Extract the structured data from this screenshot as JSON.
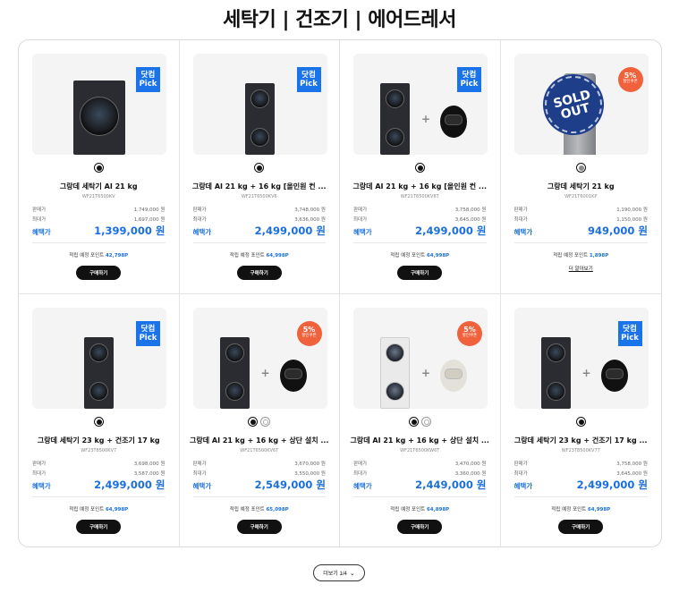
{
  "page": {
    "title": "세탁기 | 건조기 | 에어드레서"
  },
  "labels": {
    "sale_price": "판매가",
    "lowest_price": "최대가",
    "benefit_price": "혜택가",
    "points_label": "적립 예정 포인트",
    "buy": "구매하기",
    "learn_more": "더 알아보기",
    "pick_line1": "닷컴",
    "pick_line2": "Pick",
    "discount_sub": "할인쿠폰",
    "sold_out_1": "SOLD",
    "sold_out_2": "OUT",
    "plus": "+"
  },
  "colors": {
    "accent_blue": "#1a6fdc",
    "pick_badge": "#1a73e8",
    "sale_badge": "#f0623c",
    "button": "#111111"
  },
  "products": [
    {
      "name": "그랑데 세탁기 AI 21 kg",
      "model": "WF21T6500KV",
      "price1": "1,749,000 원",
      "price2": "1,697,000 원",
      "benefit": "1,399,000 원",
      "points": "42,798P",
      "badge": "pick",
      "discount": "",
      "action": "buy",
      "swatches": [
        "#111111"
      ],
      "image": "washer"
    },
    {
      "name": "그랑데 AI 21 kg + 16 kg [올인원 컨 ...",
      "model": "WF21T6500KV6",
      "price1": "3,748,000 원",
      "price2": "3,636,000 원",
      "benefit": "2,499,000 원",
      "points": "64,998P",
      "badge": "pick",
      "discount": "",
      "action": "buy",
      "swatches": [
        "#111111"
      ],
      "image": "stack"
    },
    {
      "name": "그랑데 AI 21 kg + 16 kg [올인원 컨 ...",
      "model": "WF21T6500KV6T",
      "price1": "3,758,000 원",
      "price2": "3,645,000 원",
      "benefit": "2,499,000 원",
      "points": "64,998P",
      "badge": "pick",
      "discount": "",
      "action": "buy",
      "swatches": [
        "#111111"
      ],
      "image": "stack_kit"
    },
    {
      "name": "그랑데 세탁기 21 kg",
      "model": "WF21T6001KP",
      "price1": "1,190,000 원",
      "price2": "1,150,000 원",
      "benefit": "949,000 원",
      "points": "1,898P",
      "badge": "sale",
      "discount": "5%",
      "action": "more",
      "swatches": [
        "#8a8a8a"
      ],
      "image": "soldout"
    },
    {
      "name": "그랑데 세탁기 23 kg + 건조기 17 kg",
      "model": "WF23T8500KV7",
      "price1": "3,698,000 원",
      "price2": "3,587,000 원",
      "benefit": "2,499,000 원",
      "points": "64,998P",
      "badge": "pick",
      "discount": "",
      "action": "buy",
      "swatches": [
        "#111111"
      ],
      "image": "stack"
    },
    {
      "name": "그랑데 AI 21 kg + 16 kg + 상단 설치 ...",
      "model": "WF21T6500KV6T",
      "price1": "3,670,000 원",
      "price2": "3,550,000 원",
      "benefit": "2,549,000 원",
      "points": "65,098P",
      "badge": "sale",
      "discount": "5%",
      "action": "buy",
      "swatches": [
        "#111111",
        "#ffffff"
      ],
      "image": "stack_kit"
    },
    {
      "name": "그랑데 AI 21 kg + 16 kg + 상단 설치 ...",
      "model": "WF21T6500KW6T",
      "price1": "3,470,000 원",
      "price2": "3,360,000 원",
      "benefit": "2,449,000 원",
      "points": "64,898P",
      "badge": "sale",
      "discount": "5%",
      "action": "buy",
      "swatches": [
        "#111111",
        "#ffffff"
      ],
      "image": "stack_kit_white"
    },
    {
      "name": "그랑데 세탁기 23 kg + 건조기 17 kg ...",
      "model": "WF23T8500KV7T",
      "price1": "3,758,000 원",
      "price2": "3,645,000 원",
      "benefit": "2,499,000 원",
      "points": "64,998P",
      "badge": "pick",
      "discount": "",
      "action": "buy",
      "swatches": [
        "#111111"
      ],
      "image": "stack_kit"
    }
  ],
  "pagination": {
    "more_label": "더보기 1/4"
  }
}
